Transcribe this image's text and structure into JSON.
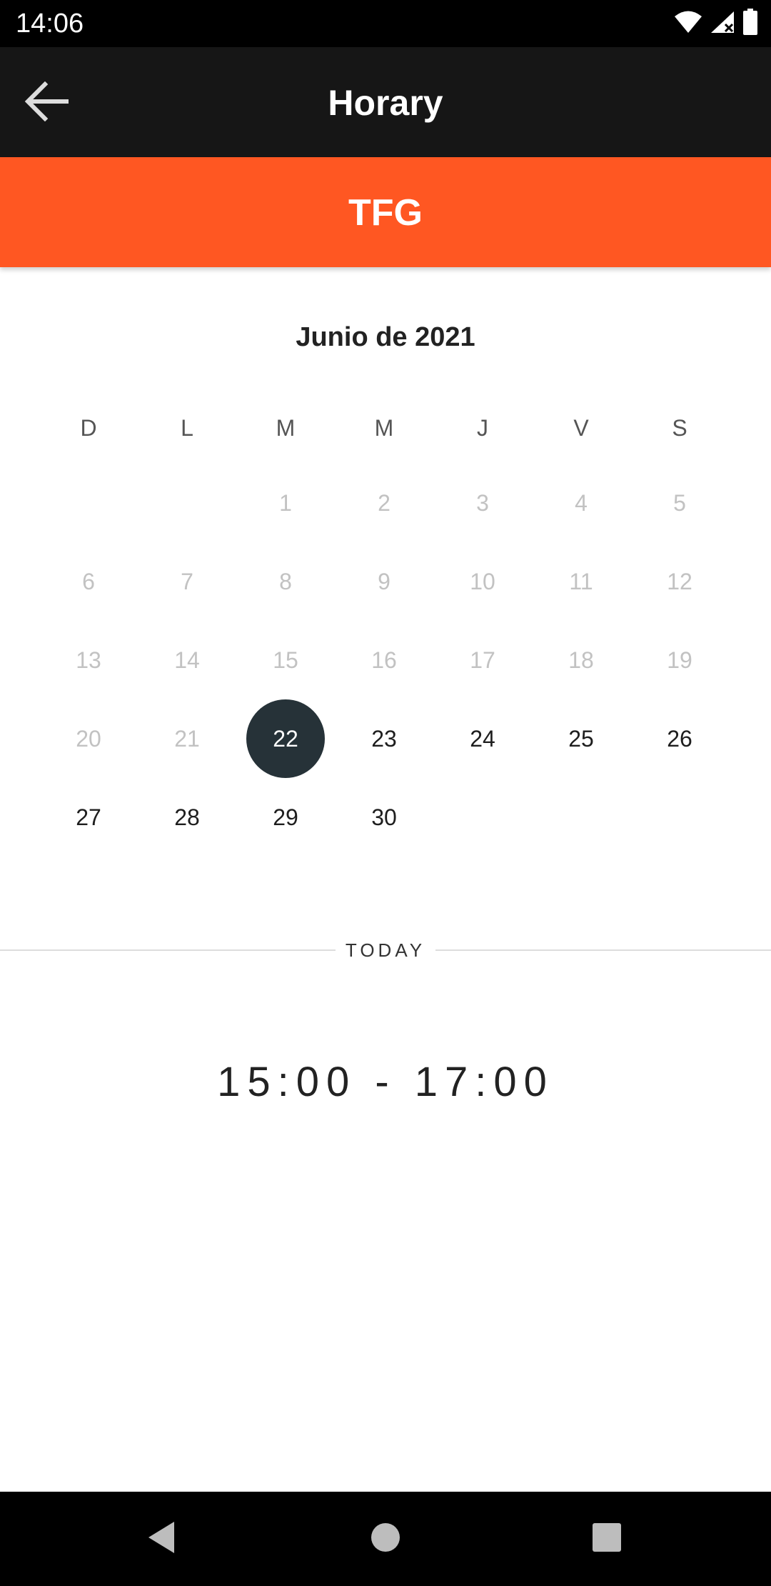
{
  "status_bar": {
    "time": "14:06",
    "icons": [
      "wifi-icon",
      "signal-icon",
      "battery-icon"
    ]
  },
  "toolbar": {
    "back_icon": "arrow-left-icon",
    "title": "Horary"
  },
  "banner": {
    "title": "TFG",
    "color": "#ff5722"
  },
  "calendar": {
    "month_title": "Junio de 2021",
    "weekdays": [
      "D",
      "L",
      "M",
      "M",
      "J",
      "V",
      "S"
    ],
    "weeks": [
      [
        null,
        null,
        "1",
        "2",
        "3",
        "4",
        "5"
      ],
      [
        "6",
        "7",
        "8",
        "9",
        "10",
        "11",
        "12"
      ],
      [
        "13",
        "14",
        "15",
        "16",
        "17",
        "18",
        "19"
      ],
      [
        "20",
        "21",
        "22",
        "23",
        "24",
        "25",
        "26"
      ],
      [
        "27",
        "28",
        "29",
        "30",
        null,
        null,
        null
      ]
    ],
    "selected_day": "22",
    "selected_color": "#263238"
  },
  "today": {
    "label": "TODAY",
    "time_range": "15:00 - 17:00"
  },
  "nav_bar": {
    "buttons": [
      "back-triangle-icon",
      "home-circle-icon",
      "recents-square-icon"
    ]
  }
}
